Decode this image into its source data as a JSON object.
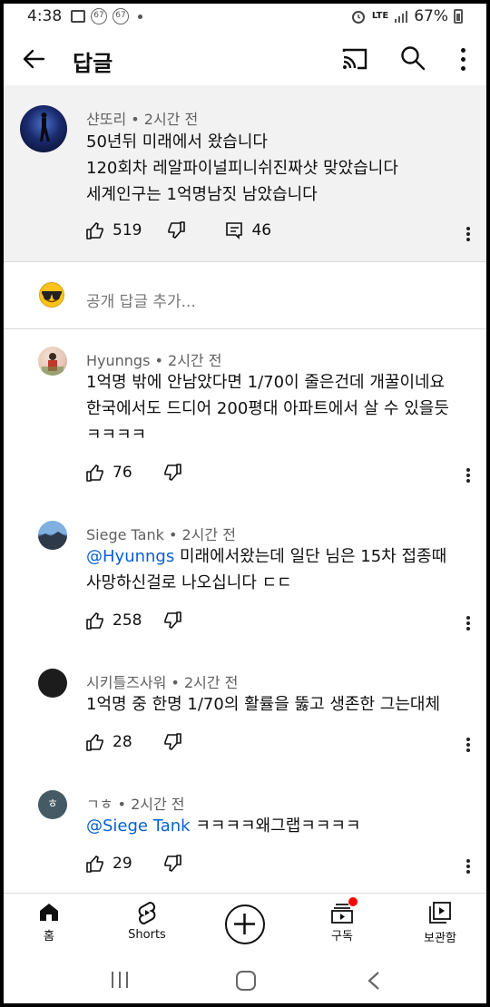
{
  "status_bar": {
    "time": "4:38",
    "notif_badge_1": "67",
    "notif_badge_2": "67",
    "network": "LTE",
    "battery": "67%"
  },
  "app_bar": {
    "title": "답글",
    "icons": [
      "back-arrow-icon",
      "cast-icon",
      "search-icon",
      "more-vert-icon"
    ]
  },
  "top_comment": {
    "author": "샨또리",
    "time": "2시간 전",
    "text": "50년뒤 미래에서 왔습니다\n120회차 레알파이널피니쉬진짜샷 맞았습니다\n세계인구는 1억명남짓 남았습니다",
    "likes": "519",
    "replies": "46"
  },
  "add_reply": {
    "placeholder": "공개 답글 추가..."
  },
  "replies": [
    {
      "author": "Hyunngs",
      "time": "2시간 전",
      "mention": "",
      "text": "1억명 밖에 안남았다면 1/70이 줄은건데 개꿀이네요\n한국에서도 드디어 200평대 아파트에서 살 수 있을듯\nㅋㅋㅋㅋ",
      "likes": "76"
    },
    {
      "author": "Siege Tank",
      "time": "2시간 전",
      "mention": "@Hyunngs",
      "text": "미래에서왔는데 일단 님은 15차 접종때\n사망하신걸로 나오십니다 ㄷㄷ",
      "likes": "258"
    },
    {
      "author": "시키틀즈사워",
      "time": "2시간 전",
      "mention": "",
      "text": "1억명 중 한명 1/70의 활률을 뚫고 생존한 그는대체",
      "likes": "28"
    },
    {
      "author": "ㄱㅎ",
      "avatar_letter": "ㅎ",
      "time": "2시간 전",
      "mention": "@Siege Tank",
      "text": "ㅋㅋㅋㅋ왜그랩ㅋㅋㅋㅋ",
      "likes": "29"
    }
  ],
  "bottom_nav": {
    "home": "홈",
    "shorts": "Shorts",
    "subscriptions": "구독",
    "library": "보관함"
  },
  "meta_separator": " • ",
  "colors": {
    "mention": "#065fd4",
    "notification_dot": "#ff0000",
    "top_comment_bg": "#f2f2f2"
  }
}
